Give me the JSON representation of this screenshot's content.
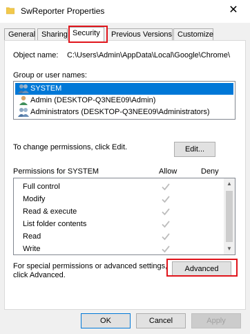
{
  "window": {
    "title": "SwReporter Properties",
    "close_glyph": "✕"
  },
  "tabs": [
    {
      "label": "General"
    },
    {
      "label": "Sharing"
    },
    {
      "label": "Security"
    },
    {
      "label": "Previous Versions"
    },
    {
      "label": "Customize"
    }
  ],
  "active_tab": "Security",
  "object": {
    "label": "Object name:",
    "path": "C:\\Users\\Admin\\AppData\\Local\\Google\\Chrome\\"
  },
  "groups": {
    "label": "Group or user names:",
    "items": [
      {
        "name": "SYSTEM",
        "icon": "users-group-icon",
        "selected": true
      },
      {
        "name": "Admin (DESKTOP-Q3NEE09\\Admin)",
        "icon": "user-icon",
        "selected": false
      },
      {
        "name": "Administrators (DESKTOP-Q3NEE09\\Administrators)",
        "icon": "users-group-icon",
        "selected": false
      }
    ]
  },
  "change_text": "To change permissions, click Edit.",
  "edit_label": "Edit...",
  "permissions": {
    "header": "Permissions for SYSTEM",
    "allow_label": "Allow",
    "deny_label": "Deny",
    "rows": [
      {
        "name": "Full control",
        "allow": true,
        "deny": false
      },
      {
        "name": "Modify",
        "allow": true,
        "deny": false
      },
      {
        "name": "Read & execute",
        "allow": true,
        "deny": false
      },
      {
        "name": "List folder contents",
        "allow": true,
        "deny": false
      },
      {
        "name": "Read",
        "allow": true,
        "deny": false
      },
      {
        "name": "Write",
        "allow": true,
        "deny": false
      }
    ]
  },
  "special": {
    "line1": "For special permissions or advanced settings,",
    "line2": "click Advanced.",
    "advanced_label": "Advanced"
  },
  "footer": {
    "ok_label": "OK",
    "cancel_label": "Cancel",
    "apply_label": "Apply"
  },
  "colors": {
    "selection": "#0078d7",
    "highlight_box": "#e0141b",
    "check_gray": "#bdbdbd"
  }
}
